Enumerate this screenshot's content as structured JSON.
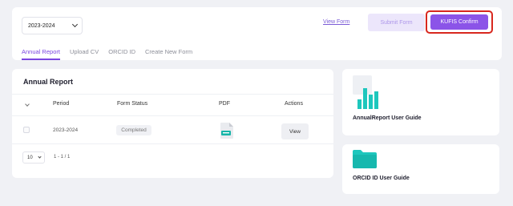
{
  "toolbar": {
    "year_selected": "2023-2024",
    "view_form_label": "View Form",
    "submit_form_label": "Submit Form",
    "kufis_confirm_label": "KUFIS Confirm"
  },
  "tabs": [
    {
      "label": "Annual Report",
      "active": true
    },
    {
      "label": "Upload CV",
      "active": false
    },
    {
      "label": "ORCID ID",
      "active": false
    },
    {
      "label": "Create New Form",
      "active": false
    }
  ],
  "annual_report": {
    "title": "Annual Report",
    "columns": [
      "Period",
      "Form Status",
      "PDF",
      "Actions"
    ],
    "rows": [
      {
        "period": "2023-2024",
        "status": "Completed",
        "pdf_icon": "pdf-file-icon",
        "action_label": "View"
      }
    ],
    "pagination": {
      "page_size": "10",
      "range": "1 - 1 / 1"
    }
  },
  "guides": [
    {
      "label": "AnnualReport User Guide",
      "icon": "bar-chart-icon"
    },
    {
      "label": "ORCID ID User Guide",
      "icon": "folder-icon"
    }
  ],
  "colors": {
    "accent": "#7b45e0",
    "kufis_button": "#8b54e8",
    "highlight_border": "#d8271e",
    "teal_icon": "#1ec7bd"
  }
}
